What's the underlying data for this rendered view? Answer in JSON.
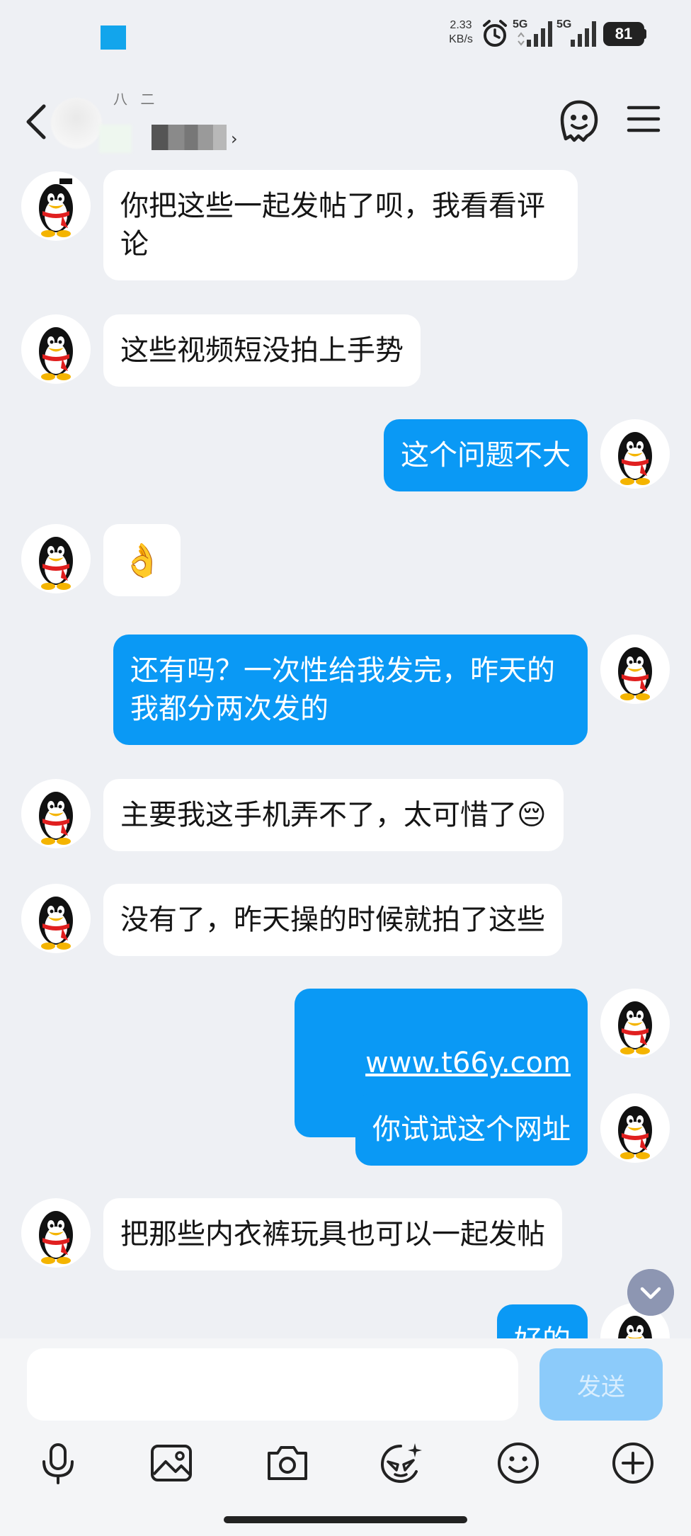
{
  "status_bar": {
    "net_speed_value": "2.33",
    "net_speed_unit": "KB/s",
    "network_1": "5G",
    "network_2": "5G",
    "battery": "81"
  },
  "header": {
    "contact_name": "八 二",
    "back_icon": "chevron-left-icon",
    "ghost_icon": "ghost-face-icon",
    "menu_icon": "hamburger-menu-icon"
  },
  "messages": [
    {
      "side": "in",
      "text": "你把这些一起发帖了呗，我看看评论"
    },
    {
      "side": "in",
      "text": "这些视频短没拍上手势"
    },
    {
      "side": "out",
      "text": "这个问题不大"
    },
    {
      "side": "in",
      "text": "👌"
    },
    {
      "side": "out",
      "text": "还有吗？一次性给我发完，昨天的我都分两次发的"
    },
    {
      "side": "in",
      "text": "主要我这手机弄不了，太可惜了😔"
    },
    {
      "side": "in",
      "text": "没有了，昨天操的时候就拍了这些"
    },
    {
      "side": "out",
      "text": "www.t66y.com"
    },
    {
      "side": "out",
      "text": "你试试这个网址"
    },
    {
      "side": "in",
      "text": "把那些内衣裤玩具也可以一起发帖"
    },
    {
      "side": "out",
      "text": "好的"
    }
  ],
  "input": {
    "placeholder": "",
    "send_label": "发送"
  },
  "toolbar": [
    "microphone-icon",
    "image-icon",
    "camera-icon",
    "sticker-icon",
    "emoji-icon",
    "plus-icon"
  ],
  "colors": {
    "background": "#eef0f4",
    "incoming_bubble": "#ffffff",
    "outgoing_bubble": "#0a99f5",
    "send_button": "#8ccbfa"
  }
}
